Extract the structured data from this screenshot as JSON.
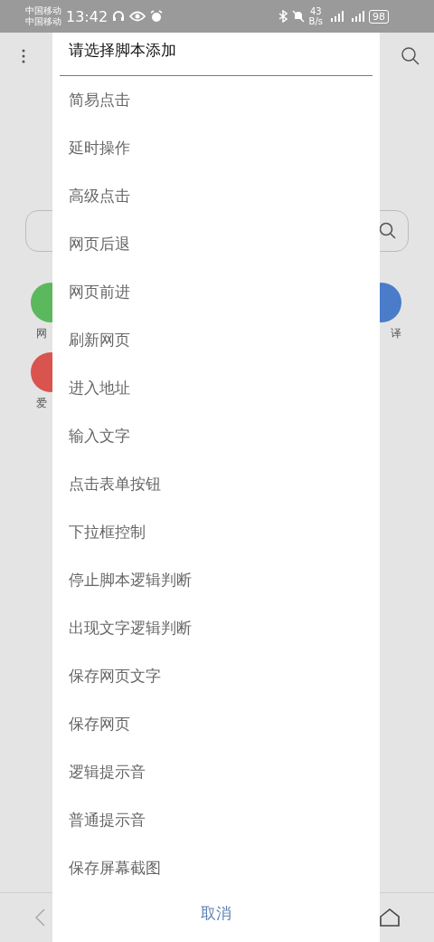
{
  "status_bar": {
    "carriers": [
      "中国移动",
      "中国移动"
    ],
    "time": "13:42",
    "net_speed": "43",
    "net_unit": "B/s",
    "battery": "98"
  },
  "background": {
    "left_shortcuts": [
      {
        "label": "网",
        "color": "#5cb85c"
      },
      {
        "label": "爱",
        "color": "#d9534f"
      }
    ],
    "right_shortcuts": [
      {
        "label": "译",
        "color": "#4a7cc9"
      }
    ]
  },
  "dialog": {
    "title": "请选择脚本添加",
    "items": [
      "简易点击",
      "延时操作",
      "高级点击",
      "网页后退",
      "网页前进",
      "刷新网页",
      "进入地址",
      "输入文字",
      "点击表单按钮",
      "下拉框控制",
      "停止脚本逻辑判断",
      "出现文字逻辑判断",
      "保存网页文字",
      "保存网页",
      "逻辑提示音",
      "普通提示音",
      "保存屏幕截图"
    ],
    "cancel": "取消"
  }
}
